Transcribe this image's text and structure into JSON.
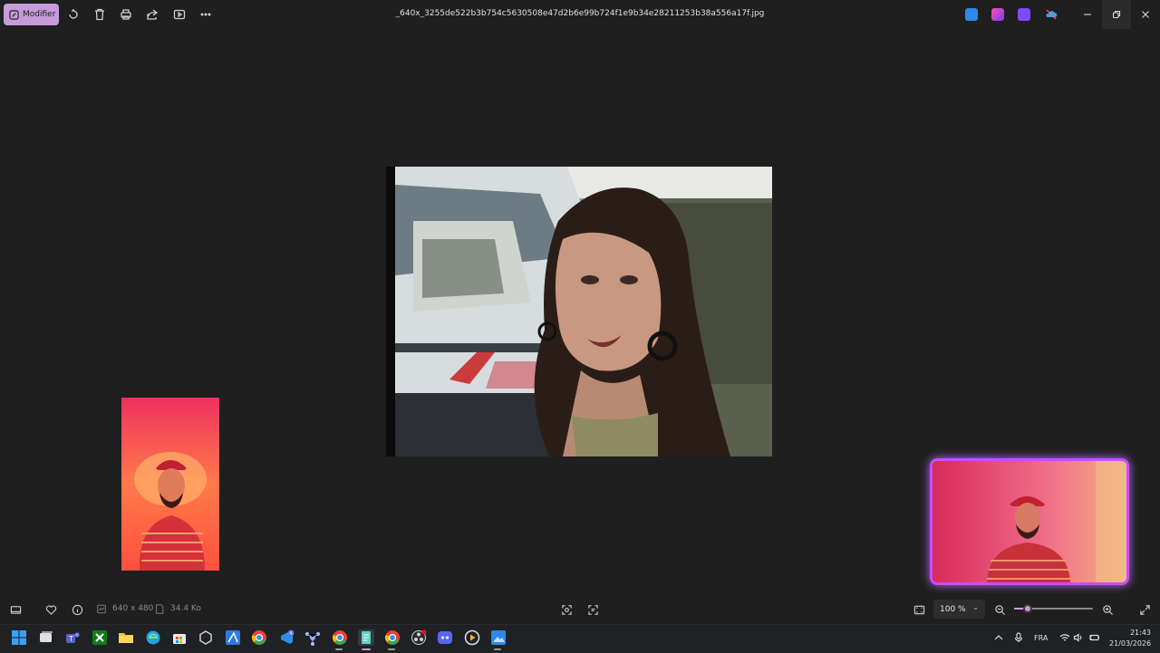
{
  "titlebar": {
    "edit_label": "Modifier",
    "file_name": "_640x_3255de522b3b754c5630508e47d2b6e99b724f1e9b34e28211253b38a556a17f.jpg",
    "tools": [
      "rotate-icon",
      "delete-icon",
      "print-icon",
      "share-icon",
      "slideshow-icon",
      "more-icon"
    ],
    "tray_apps": [
      "photos-app-icon",
      "clipchamp-icon",
      "video-editor-icon",
      "onedrive-icon"
    ],
    "window_controls": [
      "minimize-icon",
      "restore-icon",
      "close-icon"
    ]
  },
  "viewer": {
    "image_alt": "Photo",
    "webcam_left": "webcam-overlay-left",
    "webcam_right": "webcam-overlay-right"
  },
  "statusbar": {
    "dimensions": "640 x 480",
    "file_size": "34.4 Ko",
    "zoom_value": "100 %",
    "zoom_level": 0.12
  },
  "taskbar": {
    "apps": [
      "start",
      "task-view",
      "teams",
      "xbox",
      "file-explorer",
      "edge",
      "store",
      "unity",
      "affinity",
      "chrome",
      "vscode",
      "network-app",
      "chrome-profile",
      "notepad",
      "chrome-canary",
      "obs",
      "discord",
      "media-player",
      "photos"
    ],
    "badge_count": "4",
    "language": "FRA",
    "time": "21:43",
    "date": "21/03/2026"
  },
  "colors": {
    "accent": "#c69bd9",
    "background": "#1f1f1f",
    "taskbar": "#202124",
    "webcam_border": "#c84dff"
  }
}
